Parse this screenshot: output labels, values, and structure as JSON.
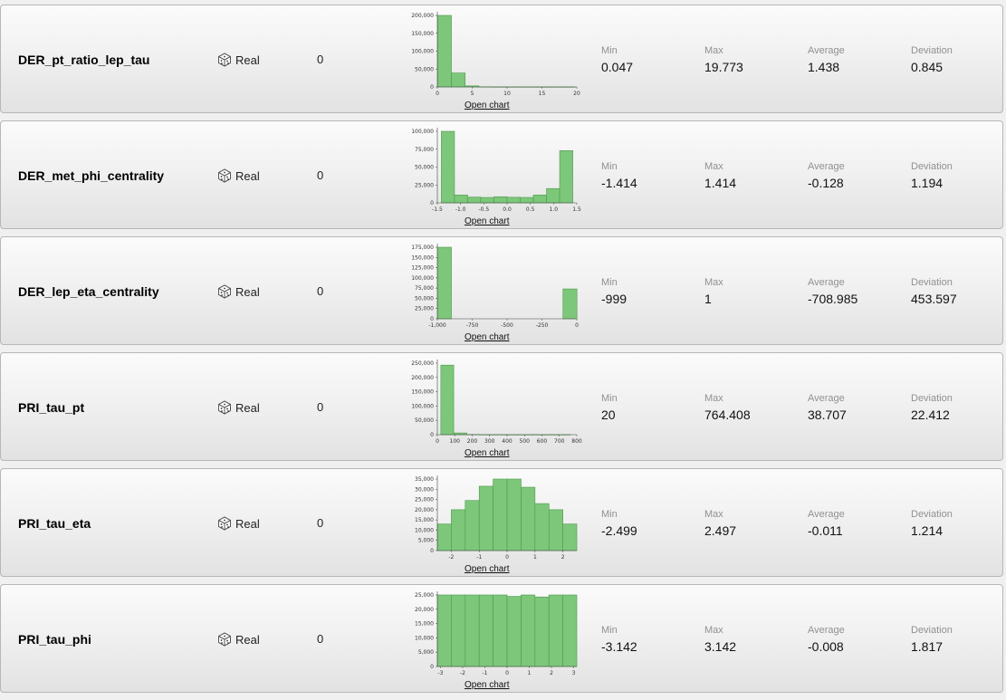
{
  "labels": {
    "min": "Min",
    "max": "Max",
    "average": "Average",
    "deviation": "Deviation",
    "open_chart": "Open chart"
  },
  "colors": {
    "bar_fill": "#7dc77a",
    "bar_stroke": "#4e9a4c",
    "row_border": "#b7b7b7"
  },
  "icons": {
    "type": "dice-icon"
  },
  "attributes": [
    {
      "name": "DER_pt_ratio_lep_tau",
      "type": "Real",
      "missing": "0",
      "min": "0.047",
      "max": "19.773",
      "average": "1.438",
      "deviation": "0.845",
      "chart_data": {
        "type": "bar",
        "x_range": [
          0,
          20
        ],
        "ylim": [
          0,
          200000
        ],
        "x_ticks": [
          0,
          5,
          10,
          15,
          20
        ],
        "x_tick_labels": [
          "0",
          "5",
          "10",
          "15",
          "20"
        ],
        "y_ticks": [
          0,
          50000,
          100000,
          150000,
          200000
        ],
        "y_tick_labels": [
          "0",
          "50,000",
          "100,000",
          "150,000",
          "200,000"
        ],
        "bins": [
          {
            "x0": 0.047,
            "x1": 2.02,
            "value": 208000
          },
          {
            "x0": 2.02,
            "x1": 3.99,
            "value": 39000
          },
          {
            "x0": 3.99,
            "x1": 5.97,
            "value": 2800
          },
          {
            "x0": 5.97,
            "x1": 7.94,
            "value": 300
          },
          {
            "x0": 7.94,
            "x1": 9.91,
            "value": 100
          },
          {
            "x0": 9.91,
            "x1": 11.88,
            "value": 40
          },
          {
            "x0": 11.88,
            "x1": 13.85,
            "value": 20
          },
          {
            "x0": 13.85,
            "x1": 15.83,
            "value": 10
          },
          {
            "x0": 15.83,
            "x1": 17.8,
            "value": 5
          },
          {
            "x0": 17.8,
            "x1": 19.773,
            "value": 2
          }
        ]
      }
    },
    {
      "name": "DER_met_phi_centrality",
      "type": "Real",
      "missing": "0",
      "min": "-1.414",
      "max": "1.414",
      "average": "-0.128",
      "deviation": "1.194",
      "chart_data": {
        "type": "bar",
        "x_range": [
          -1.5,
          1.5
        ],
        "ylim": [
          0,
          100000
        ],
        "x_ticks": [
          -1.5,
          -1.0,
          -0.5,
          0.0,
          0.5,
          1.0,
          1.5
        ],
        "x_tick_labels": [
          "-1.5",
          "-1.0",
          "-0.5",
          "0.0",
          "0.5",
          "1.0",
          "1.5"
        ],
        "y_ticks": [
          0,
          25000,
          50000,
          75000,
          100000
        ],
        "y_tick_labels": [
          "0",
          "25,000",
          "50,000",
          "75,000",
          "100,000"
        ],
        "bins": [
          {
            "x0": -1.414,
            "x1": -1.131,
            "value": 101000
          },
          {
            "x0": -1.131,
            "x1": -0.848,
            "value": 11000
          },
          {
            "x0": -0.848,
            "x1": -0.566,
            "value": 8000
          },
          {
            "x0": -0.566,
            "x1": -0.283,
            "value": 7500
          },
          {
            "x0": -0.283,
            "x1": 0.0,
            "value": 8500
          },
          {
            "x0": 0.0,
            "x1": 0.283,
            "value": 7800
          },
          {
            "x0": 0.283,
            "x1": 0.566,
            "value": 7600
          },
          {
            "x0": 0.566,
            "x1": 0.848,
            "value": 11000
          },
          {
            "x0": 0.848,
            "x1": 1.131,
            "value": 20000
          },
          {
            "x0": 1.131,
            "x1": 1.414,
            "value": 73000
          }
        ]
      }
    },
    {
      "name": "DER_lep_eta_centrality",
      "type": "Real",
      "missing": "0",
      "min": "-999",
      "max": "1",
      "average": "-708.985",
      "deviation": "453.597",
      "chart_data": {
        "type": "bar",
        "x_range": [
          -1000,
          0
        ],
        "ylim": [
          0,
          175000
        ],
        "x_ticks": [
          -1000,
          -750,
          -500,
          -250,
          0
        ],
        "x_tick_labels": [
          "-1,000",
          "-750",
          "-500",
          "-250",
          "0"
        ],
        "y_ticks": [
          0,
          25000,
          50000,
          75000,
          100000,
          125000,
          150000,
          175000
        ],
        "y_tick_labels": [
          "0",
          "25,000",
          "50,000",
          "75,000",
          "100,000",
          "125,000",
          "150,000",
          "175,000"
        ],
        "bins": [
          {
            "x0": -999,
            "x1": -899,
            "value": 177000
          },
          {
            "x0": -899,
            "x1": -799,
            "value": 0
          },
          {
            "x0": -799,
            "x1": -699,
            "value": 0
          },
          {
            "x0": -699,
            "x1": -599,
            "value": 0
          },
          {
            "x0": -599,
            "x1": -499,
            "value": 0
          },
          {
            "x0": -499,
            "x1": -399,
            "value": 0
          },
          {
            "x0": -399,
            "x1": -299,
            "value": 0
          },
          {
            "x0": -299,
            "x1": -199,
            "value": 0
          },
          {
            "x0": -199,
            "x1": -99,
            "value": 0
          },
          {
            "x0": -99,
            "x1": 1,
            "value": 73000
          }
        ]
      }
    },
    {
      "name": "PRI_tau_pt",
      "type": "Real",
      "missing": "0",
      "min": "20",
      "max": "764.408",
      "average": "38.707",
      "deviation": "22.412",
      "chart_data": {
        "type": "bar",
        "x_range": [
          0,
          800
        ],
        "ylim": [
          0,
          250000
        ],
        "x_ticks": [
          0,
          100,
          200,
          300,
          400,
          500,
          600,
          700,
          800
        ],
        "x_tick_labels": [
          "0",
          "100",
          "200",
          "300",
          "400",
          "500",
          "600",
          "700",
          "800"
        ],
        "y_ticks": [
          0,
          50000,
          100000,
          150000,
          200000,
          250000
        ],
        "y_tick_labels": [
          "0",
          "50,000",
          "100,000",
          "150,000",
          "200,000",
          "250,000"
        ],
        "bins": [
          {
            "x0": 20,
            "x1": 94,
            "value": 243000
          },
          {
            "x0": 94,
            "x1": 169,
            "value": 6000
          },
          {
            "x0": 169,
            "x1": 243,
            "value": 800
          },
          {
            "x0": 243,
            "x1": 318,
            "value": 200
          },
          {
            "x0": 318,
            "x1": 392,
            "value": 60
          },
          {
            "x0": 392,
            "x1": 466,
            "value": 20
          },
          {
            "x0": 466,
            "x1": 541,
            "value": 10
          },
          {
            "x0": 541,
            "x1": 615,
            "value": 5
          },
          {
            "x0": 615,
            "x1": 690,
            "value": 3
          },
          {
            "x0": 690,
            "x1": 764.408,
            "value": 2
          }
        ]
      }
    },
    {
      "name": "PRI_tau_eta",
      "type": "Real",
      "missing": "0",
      "min": "-2.499",
      "max": "2.497",
      "average": "-0.011",
      "deviation": "1.214",
      "chart_data": {
        "type": "bar",
        "x_range": [
          -2.499,
          2.497
        ],
        "ylim": [
          0,
          35000
        ],
        "x_ticks": [
          -2,
          -1,
          0,
          1,
          2
        ],
        "x_tick_labels": [
          "-2",
          "-1",
          "0",
          "1",
          "2"
        ],
        "y_ticks": [
          0,
          5000,
          10000,
          15000,
          20000,
          25000,
          30000,
          35000
        ],
        "y_tick_labels": [
          "0",
          "5,000",
          "10,000",
          "15,000",
          "20,000",
          "25,000",
          "30,000",
          "35,000"
        ],
        "bins": [
          {
            "x0": -2.499,
            "x1": -1.999,
            "value": 13000
          },
          {
            "x0": -1.999,
            "x1": -1.5,
            "value": 20000
          },
          {
            "x0": -1.5,
            "x1": -1.0,
            "value": 24500
          },
          {
            "x0": -1.0,
            "x1": -0.5,
            "value": 31500
          },
          {
            "x0": -0.5,
            "x1": 0.0,
            "value": 35000
          },
          {
            "x0": 0.0,
            "x1": 0.5,
            "value": 35000
          },
          {
            "x0": 0.5,
            "x1": 1.0,
            "value": 31000
          },
          {
            "x0": 1.0,
            "x1": 1.5,
            "value": 23000
          },
          {
            "x0": 1.5,
            "x1": 2.0,
            "value": 20000
          },
          {
            "x0": 2.0,
            "x1": 2.497,
            "value": 13000
          }
        ]
      }
    },
    {
      "name": "PRI_tau_phi",
      "type": "Real",
      "missing": "0",
      "min": "-3.142",
      "max": "3.142",
      "average": "-0.008",
      "deviation": "1.817",
      "chart_data": {
        "type": "bar",
        "x_range": [
          -3.142,
          3.142
        ],
        "ylim": [
          0,
          25000
        ],
        "x_ticks": [
          -3,
          -2,
          -1,
          0,
          1,
          2,
          3
        ],
        "x_tick_labels": [
          "-3",
          "-2",
          "-1",
          "0",
          "1",
          "2",
          "3"
        ],
        "y_ticks": [
          0,
          5000,
          10000,
          15000,
          20000,
          25000
        ],
        "y_tick_labels": [
          "0",
          "5,000",
          "10,000",
          "15,000",
          "20,000",
          "25,000"
        ],
        "bins": [
          {
            "x0": -3.142,
            "x1": -2.514,
            "value": 25800
          },
          {
            "x0": -2.514,
            "x1": -1.885,
            "value": 25000
          },
          {
            "x0": -1.885,
            "x1": -1.257,
            "value": 25500
          },
          {
            "x0": -1.257,
            "x1": -0.628,
            "value": 26200
          },
          {
            "x0": -0.628,
            "x1": 0.0,
            "value": 25200
          },
          {
            "x0": 0.0,
            "x1": 0.628,
            "value": 24500
          },
          {
            "x0": 0.628,
            "x1": 1.257,
            "value": 25100
          },
          {
            "x0": 1.257,
            "x1": 1.885,
            "value": 24300
          },
          {
            "x0": 1.885,
            "x1": 2.514,
            "value": 25200
          },
          {
            "x0": 2.514,
            "x1": 3.142,
            "value": 25700
          }
        ]
      }
    }
  ]
}
